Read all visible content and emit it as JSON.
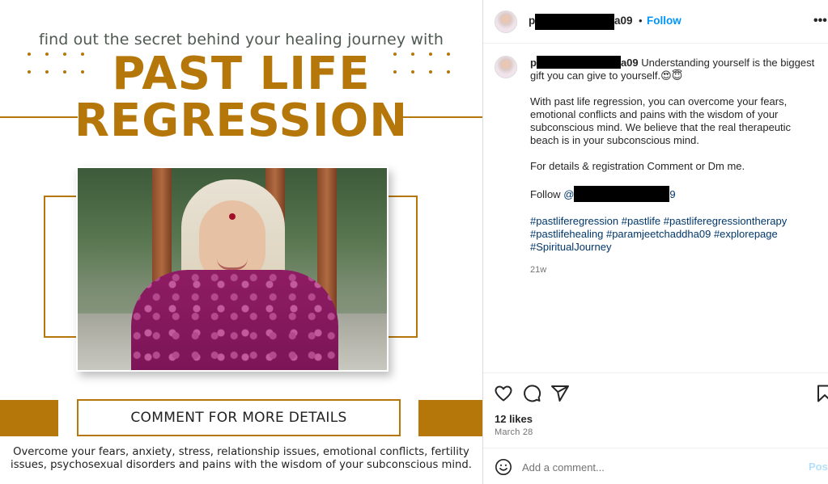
{
  "post_image": {
    "tagline": "find out the secret behind your healing journey with",
    "headline_line1": "PAST LIFE",
    "headline_line2": "REGRESSION",
    "cta": "COMMENT FOR MORE DETAILS",
    "bottom_copy_line1": "Overcome your fears, anxiety, stress, relationship issues, emotional conflicts, fertility",
    "bottom_copy_line2": "issues, psychosexual disorders and pains with the wisdom of your subconscious mind.",
    "accent_color": "#b5770a"
  },
  "header": {
    "username_prefix": "p",
    "username_suffix": "a09",
    "separator": "•",
    "follow_label": "Follow",
    "more_icon": "more-horizontal-icon"
  },
  "caption": {
    "username_prefix": "p",
    "username_suffix": "a09",
    "intro": "Understanding yourself is the biggest gift you can give to yourself.😍😇",
    "para2": "With past life regression, you can overcome your fears, emotional conflicts and pains with the wisdom of your subconscious mind. We believe that the real therapeutic beach is in your subconscious mind.",
    "para3": "For details & registration Comment or Dm me.",
    "follow_prefix": "Follow",
    "mention_prefix": "@",
    "mention_suffix": "9",
    "hashtags": "#pastliferegression #pastlife #pastliferegressiontherapy #pastlifehealing #paramjeetchaddha09 #explorepage #SpiritualJourney",
    "age": "21w"
  },
  "actions": {
    "icons": [
      "heart-icon",
      "comment-icon",
      "share-icon",
      "bookmark-icon"
    ],
    "likes": "12 likes",
    "date": "March 28"
  },
  "comment_box": {
    "placeholder": "Add a comment...",
    "post_label": "Post"
  },
  "colors": {
    "follow_blue": "#0095f6",
    "link_blue": "#00376b",
    "post_disabled": "#b3dffc"
  }
}
